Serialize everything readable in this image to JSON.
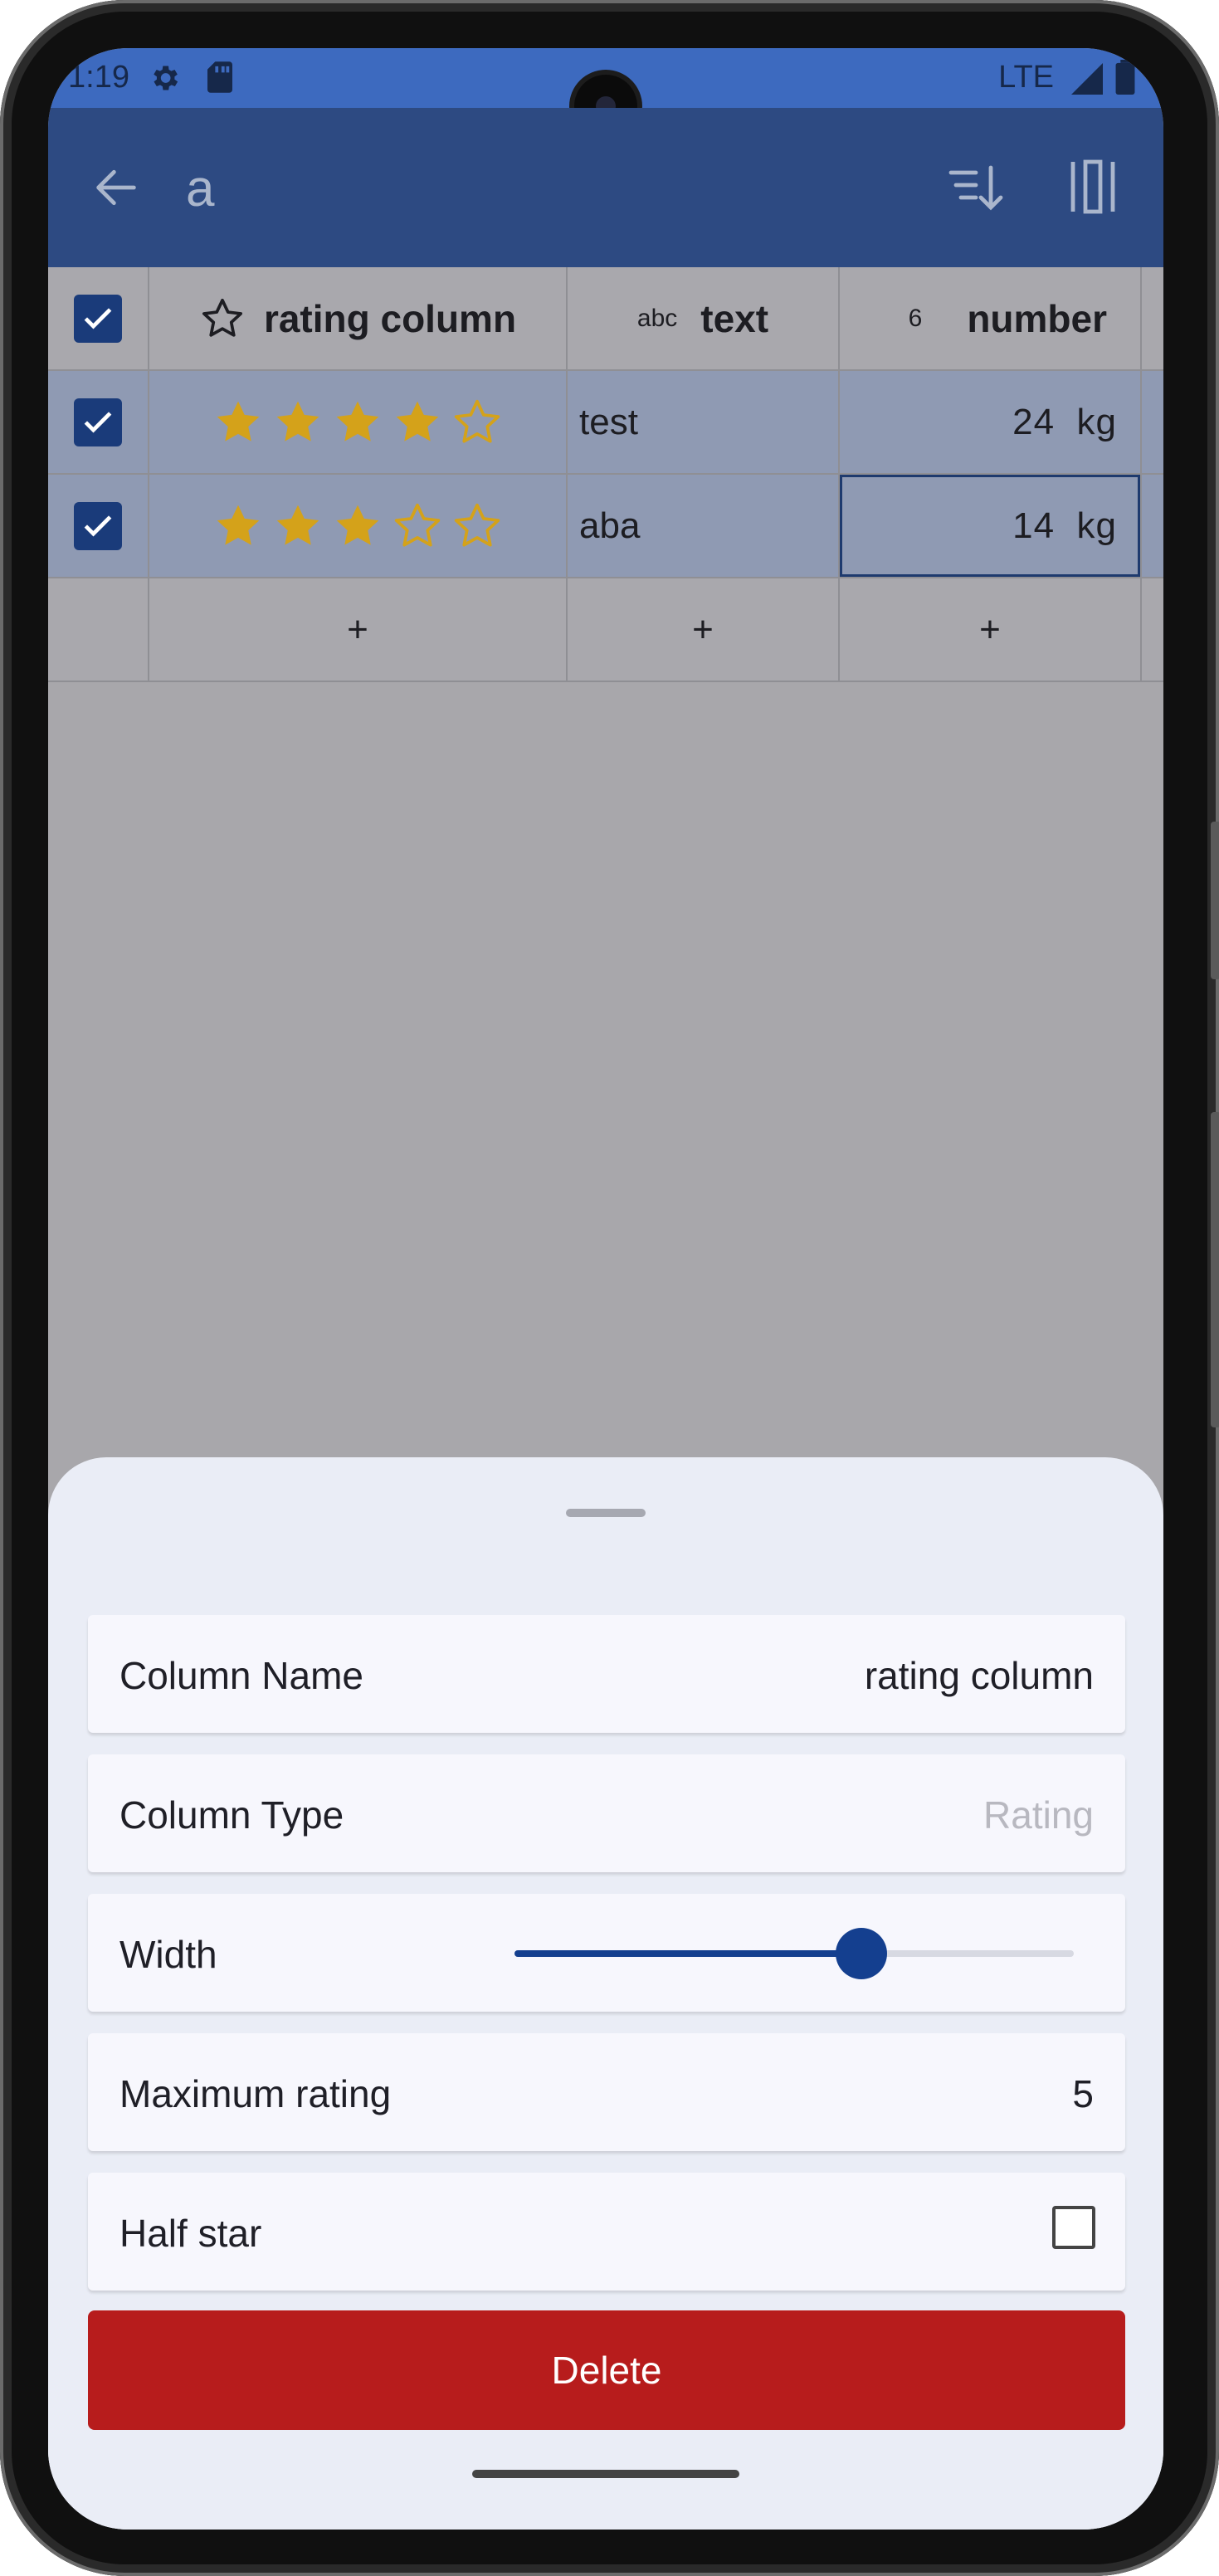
{
  "status_bar": {
    "time": "1:19",
    "network": "LTE",
    "icons": [
      "gear-icon",
      "sd-card-icon",
      "signal-icon",
      "battery-icon"
    ]
  },
  "app_bar": {
    "title": "a",
    "icons": [
      "back-arrow-icon",
      "sort-icon",
      "columns-icon"
    ]
  },
  "table": {
    "columns": [
      {
        "icon": "star-outline-icon",
        "label": "rating column"
      },
      {
        "icon": "abc-icon",
        "icon_text": "abc",
        "label": "text"
      },
      {
        "icon": "number-icon",
        "icon_text": "6",
        "label": "number"
      }
    ],
    "rows": [
      {
        "rating": 4,
        "max_rating": 5,
        "text": "test",
        "number": "24",
        "unit": "kg",
        "checked": true
      },
      {
        "rating": 3,
        "max_rating": 5,
        "text": "aba",
        "number": "14",
        "unit": "kg",
        "checked": true
      }
    ],
    "add_symbol": "+",
    "colors": {
      "star_filled": "#d4a21a",
      "star_empty": "#d4a21a",
      "row_selected": "#8f9ab3"
    }
  },
  "sheet": {
    "column_name_label": "Column Name",
    "column_name_value": "rating column",
    "column_type_label": "Column Type",
    "column_type_value": "Rating",
    "width_label": "Width",
    "width_fraction": 0.62,
    "max_rating_label": "Maximum rating",
    "max_rating_value": "5",
    "half_star_label": "Half star",
    "half_star_checked": false,
    "delete_label": "Delete",
    "colors": {
      "accent": "#143f8f",
      "delete": "#b71c1c"
    }
  }
}
